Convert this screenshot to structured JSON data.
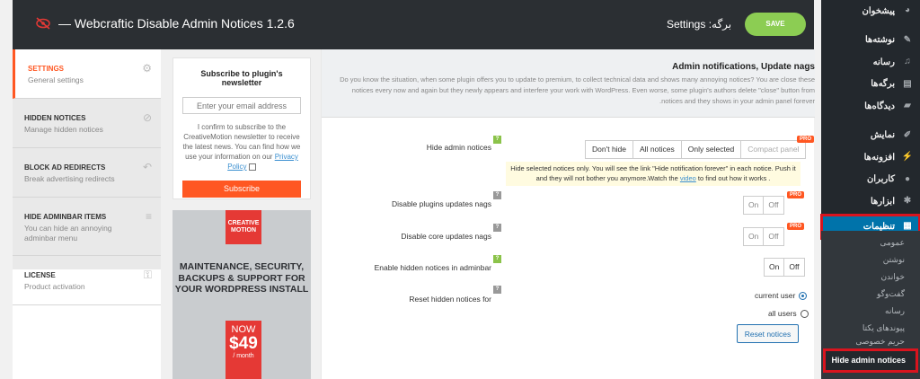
{
  "plugin": {
    "title": "— Webcraftic Disable Admin Notices 1.2.6"
  },
  "topbar": {
    "settings_label": "برگه: Settings",
    "save_label": "SAVE"
  },
  "nav": [
    {
      "title": "SETTINGS",
      "desc": "General settings",
      "active": true
    },
    {
      "title": "HIDDEN NOTICES",
      "desc": "Manage hidden notices"
    },
    {
      "title": "BLOCK AD REDIRECTS",
      "desc": "Break advertising redirects"
    },
    {
      "title": "HIDE ADMINBAR ITEMS",
      "desc": "You can hide an annoying adminbar menu"
    },
    {
      "title": "LICENSE",
      "desc": "Product activation"
    }
  ],
  "newsletter": {
    "title": "Subscribe to plugin's newsletter",
    "email_placeholder": "Enter your email address",
    "consent": "I confirm to subscribe to the CreativeMotion newsletter to receive the latest news. You can find how we use your information on our",
    "privacy": "Privacy Policy",
    "button": "Subscribe"
  },
  "ad": {
    "logo": "CREATIVE MOTION",
    "headline": "MAINTENANCE, SECURITY, BACKUPS & SUPPORT FOR YOUR WORDPRESS INSTALL",
    "now": "NOW",
    "price": "$49",
    "period": "/ month"
  },
  "main": {
    "heading": "Admin notifications, Update nags",
    "intro": "Do you know the situation, when some plugin offers you to update to premium, to collect technical data and shows many annoying notices? You are close these notices every now and again but they newly appears and interfere your work with WordPress. Even worse, some plugin's authors delete \"close\" button from notices and they shows in your admin panel forever.",
    "hide_label": "Hide admin notices",
    "hide_options": [
      "Don't hide",
      "All notices",
      "Only selected",
      "Compact panel"
    ],
    "pro": "PRO",
    "hint_text": "Hide selected notices only. You will see the link \"Hide notification forever\" in each notice. Push it and they will not bother you anymore.Watch the",
    "hint_link": "video",
    "hint_end": "to find out how it works .",
    "plugins_label": "Disable plugins updates nags",
    "core_label": "Disable core updates nags",
    "adminbar_label": "Enable hidden notices in adminbar",
    "reset_label": "Reset hidden notices for",
    "on": "On",
    "off": "Off",
    "current_user": "current user",
    "all_users": "all users",
    "reset_button": "Reset notices"
  },
  "wpmenu": {
    "items": [
      "پیشخوان",
      "نوشته‌ها",
      "رسانه",
      "برگه‌ها",
      "دیدگاه‌ها",
      "نمایش",
      "افزونه‌ها",
      "کاربران",
      "ابزارها",
      "تنظیمات"
    ],
    "submenu": [
      "عمومی",
      "نوشتن",
      "خواندن",
      "گفت‌وگو",
      "رسانه",
      "پیوندهای یکتا",
      "حریم خصوصی"
    ],
    "current_sub": "Hide admin notices"
  }
}
